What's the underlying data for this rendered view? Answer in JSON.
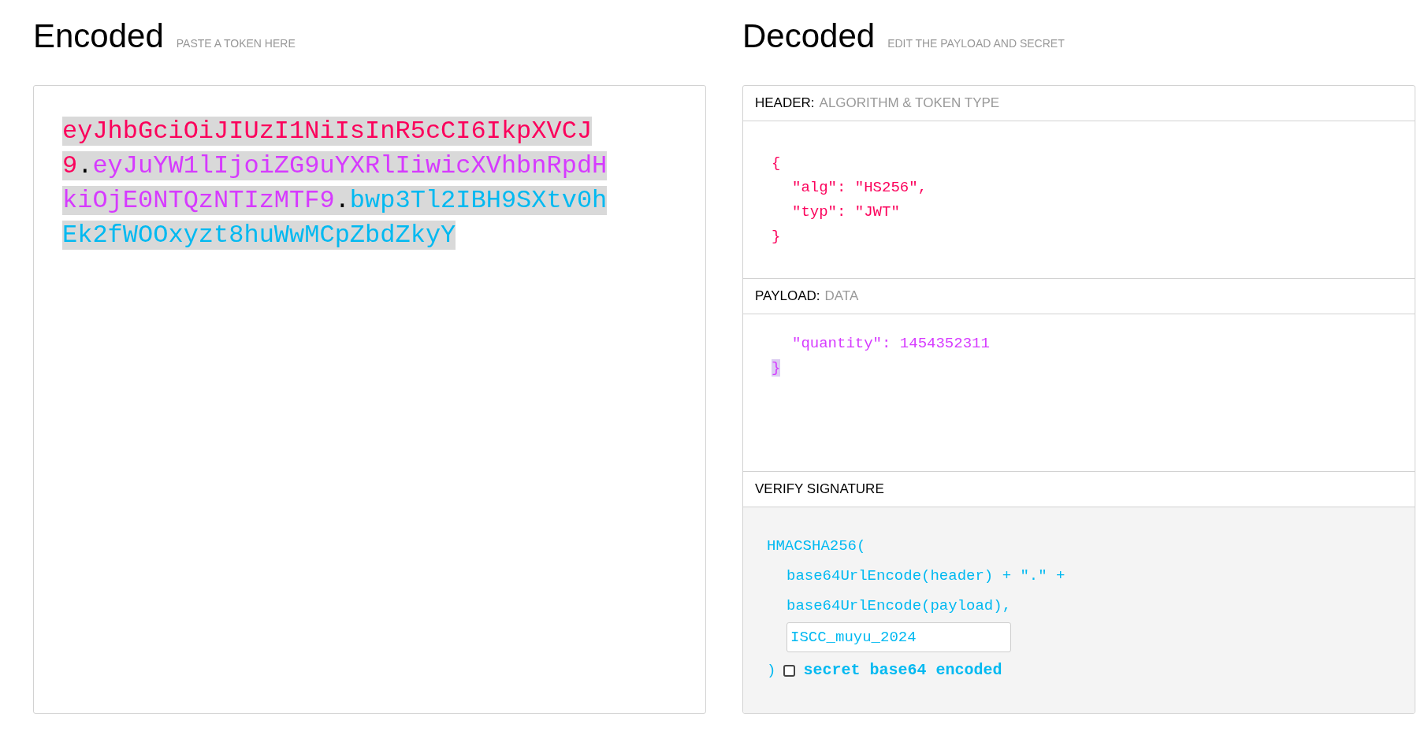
{
  "encoded": {
    "title": "Encoded",
    "hint": "PASTE A TOKEN HERE",
    "token": [
      {
        "kind": "header",
        "text": "eyJhbGciOiJIUzI1NiIsInR5cCI6IkpXVCJ9"
      },
      {
        "kind": "dot",
        "text": "."
      },
      {
        "kind": "payload",
        "text": "eyJuYW1lIjoiZG9uYXRlIiwicXVhbnRpdHkiOjE0NTQzNTIzMTF9"
      },
      {
        "kind": "dot",
        "text": "."
      },
      {
        "kind": "signature",
        "text": "bwp3Tl2IBH9SXtv0hEk2fWOOxyzt8huWwMCpZbdZkyY"
      }
    ]
  },
  "decoded": {
    "title": "Decoded",
    "hint": "EDIT THE PAYLOAD AND SECRET",
    "header": {
      "label": "HEADER:",
      "sublabel": "ALGORITHM & TOKEN TYPE",
      "lines": [
        {
          "kind": "brace",
          "text": "{",
          "highlighted": false
        },
        {
          "kind": "member",
          "text": "\"alg\": \"HS256\",",
          "highlighted": false
        },
        {
          "kind": "member",
          "text": "\"typ\": \"JWT\"",
          "highlighted": false
        },
        {
          "kind": "brace",
          "text": "}",
          "highlighted": false
        }
      ]
    },
    "payload": {
      "label": "PAYLOAD:",
      "sublabel": "DATA",
      "lines": [
        {
          "kind": "member",
          "text": "\"quantity\": 1454352311",
          "highlighted": false
        },
        {
          "kind": "brace",
          "text": "}",
          "highlighted": true
        }
      ]
    },
    "signature": {
      "label": "VERIFY SIGNATURE",
      "lines": [
        "HMACSHA256(",
        "base64UrlEncode(header) + \".\" +",
        "base64UrlEncode(payload),"
      ],
      "secret": "ISCC_muyu_2024",
      "close": ")",
      "encoded_checkbox": {
        "label": "secret base64 encoded",
        "checked": false
      }
    }
  }
}
